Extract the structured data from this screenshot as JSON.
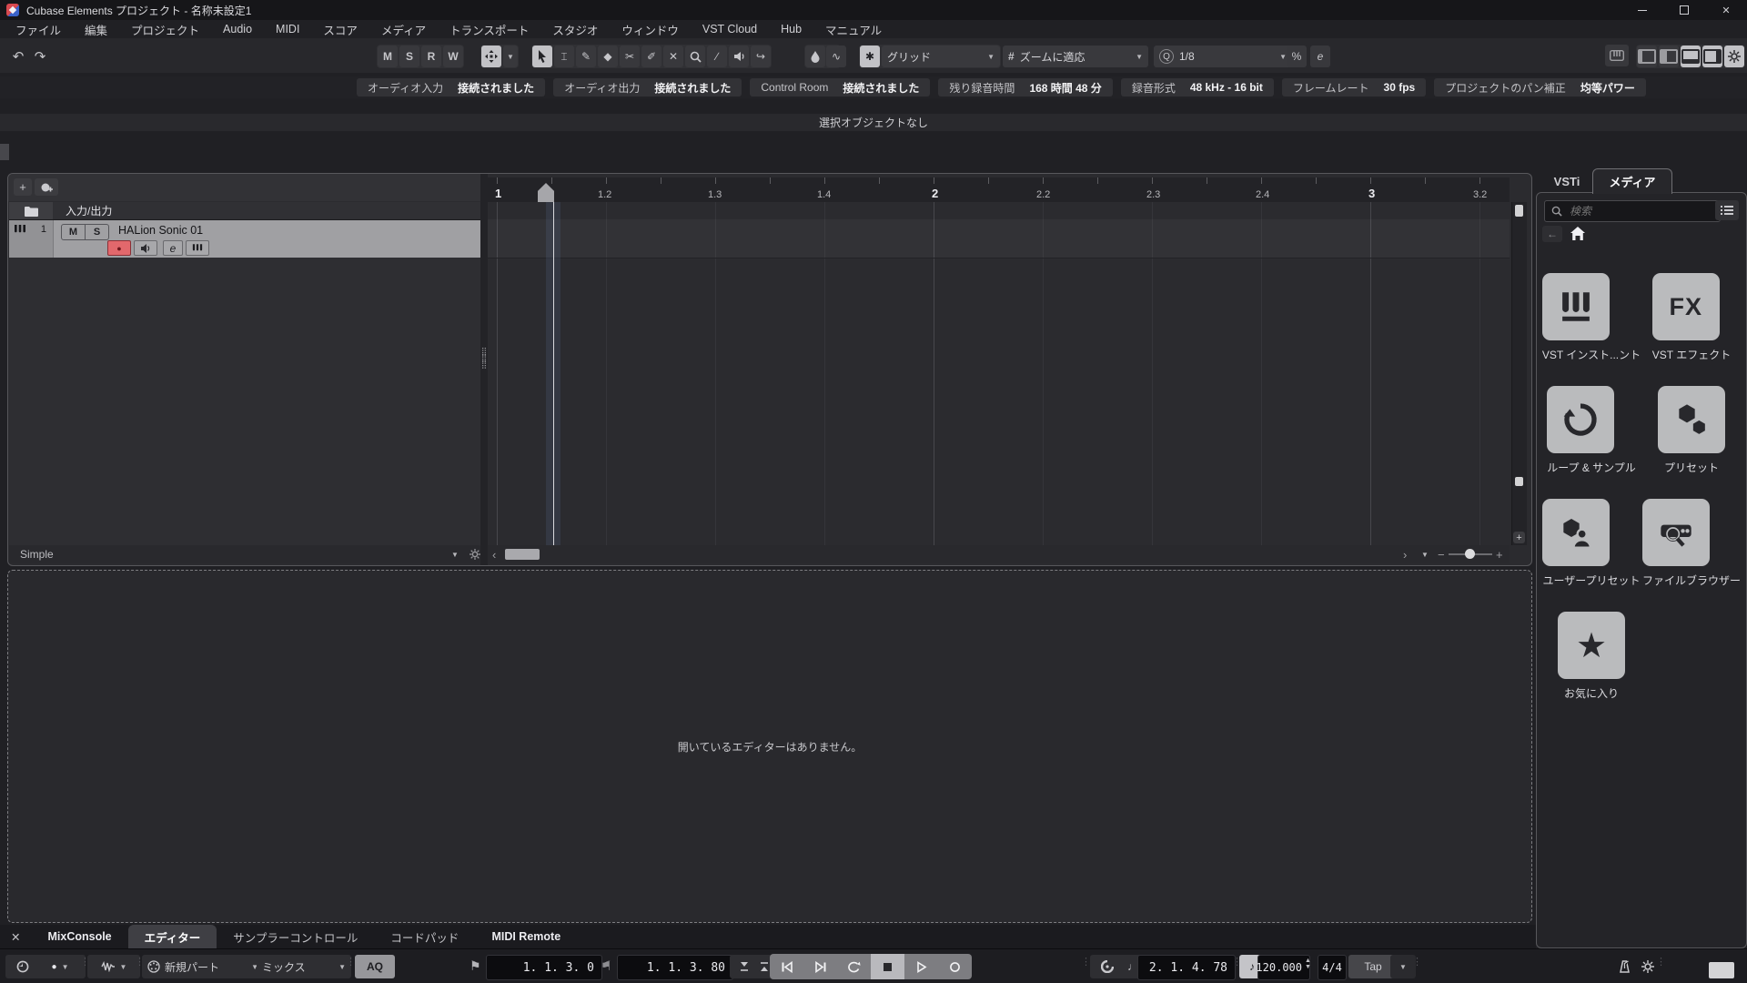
{
  "titlebar": {
    "title": "Cubase Elements プロジェクト - 名称未設定1"
  },
  "menu": {
    "items": [
      "ファイル",
      "編集",
      "プロジェクト",
      "Audio",
      "MIDI",
      "スコア",
      "メディア",
      "トランスポート",
      "スタジオ",
      "ウィンドウ",
      "VST Cloud",
      "Hub",
      "マニュアル"
    ]
  },
  "toolbar": {
    "monitor_buttons": [
      "M",
      "S",
      "R",
      "W"
    ],
    "grid_type": {
      "label": "グリッド"
    },
    "zoom_preset": {
      "icon": "#",
      "label": "ズームに適応"
    },
    "quantize": {
      "icon": "Q",
      "label": "1/8"
    },
    "iterative_quantize": "%",
    "edit_button": "e"
  },
  "info_line": {
    "items": [
      {
        "label": "オーディオ入力",
        "value": "接続されました"
      },
      {
        "label": "オーディオ出力",
        "value": "接続されました"
      },
      {
        "label": "Control Room",
        "value": "接続されました"
      },
      {
        "label": "残り録音時間",
        "value": "168 時間 48 分"
      },
      {
        "label": "録音形式",
        "value": "48 kHz - 16 bit"
      },
      {
        "label": "フレームレート",
        "value": "30 fps"
      },
      {
        "label": "プロジェクトのパン補正",
        "value": "均等パワー"
      }
    ]
  },
  "status_line": {
    "message": "選択オブジェクトなし"
  },
  "track_area": {
    "io_label": "入力/出力",
    "track": {
      "index": "1",
      "mute": "M",
      "solo": "S",
      "name": "HALion Sonic 01",
      "edit": "e"
    },
    "preset_name": "Simple"
  },
  "ruler": {
    "ticks": [
      {
        "label": "1"
      },
      {
        "label": "1.2"
      },
      {
        "label": "1.3"
      },
      {
        "label": "1.4"
      },
      {
        "label": "2"
      },
      {
        "label": "2.2"
      },
      {
        "label": "2.3"
      },
      {
        "label": "2.4"
      },
      {
        "label": "3"
      },
      {
        "label": "3.2"
      }
    ]
  },
  "lower_zone": {
    "message": "開いているエディターはありません。"
  },
  "bottom_tabs": {
    "items": [
      "MixConsole",
      "エディター",
      "サンプラーコントロール",
      "コードパッド",
      "MIDI Remote"
    ],
    "active": "エディター"
  },
  "right_zone": {
    "tabs": [
      "VSTi",
      "メディア"
    ],
    "active_tab": "メディア",
    "search_placeholder": "検索",
    "fx_icon_text": "FX",
    "tiles": [
      {
        "label": "VST インスト...ント"
      },
      {
        "label": "VST エフェクト"
      },
      {
        "label": "ループ & サンプル"
      },
      {
        "label": "プリセット"
      },
      {
        "label": "ユーザープリセット"
      },
      {
        "label": "ファイルブラウザー"
      },
      {
        "label": "お気に入り"
      }
    ]
  },
  "transport": {
    "new_part_label": "新規パート",
    "mix_label": "ミックス",
    "aq_label": "AQ",
    "left_locator": "1. 1. 3.  0",
    "right_locator": "1. 1. 3. 80",
    "position": "2. 1. 4. 78",
    "tempo": "120.000",
    "time_signature": "4/4",
    "tap_label": "Tap"
  },
  "icons": {
    "plus": "+",
    "chevron_down": "▼",
    "up": "▲",
    "down": "▼",
    "undo": "↶",
    "redo": "↷",
    "close": "✕",
    "dots": "⋮",
    "grip": "⣿",
    "lt": "‹",
    "gt": "›",
    "minus": "−",
    "star": "★",
    "note_quarter": "♩",
    "note_eighth": "♪",
    "left_arrow": "←",
    "flag": "⚑",
    "ibeam": "⌶",
    "pencil": "✎",
    "eraser": "◆",
    "scissors": "✂",
    "glue": "✐",
    "mute_x": "✕",
    "line": "∕",
    "curve": "↪",
    "snap": "✱",
    "autowave": "∿",
    "record_dot": "●"
  }
}
